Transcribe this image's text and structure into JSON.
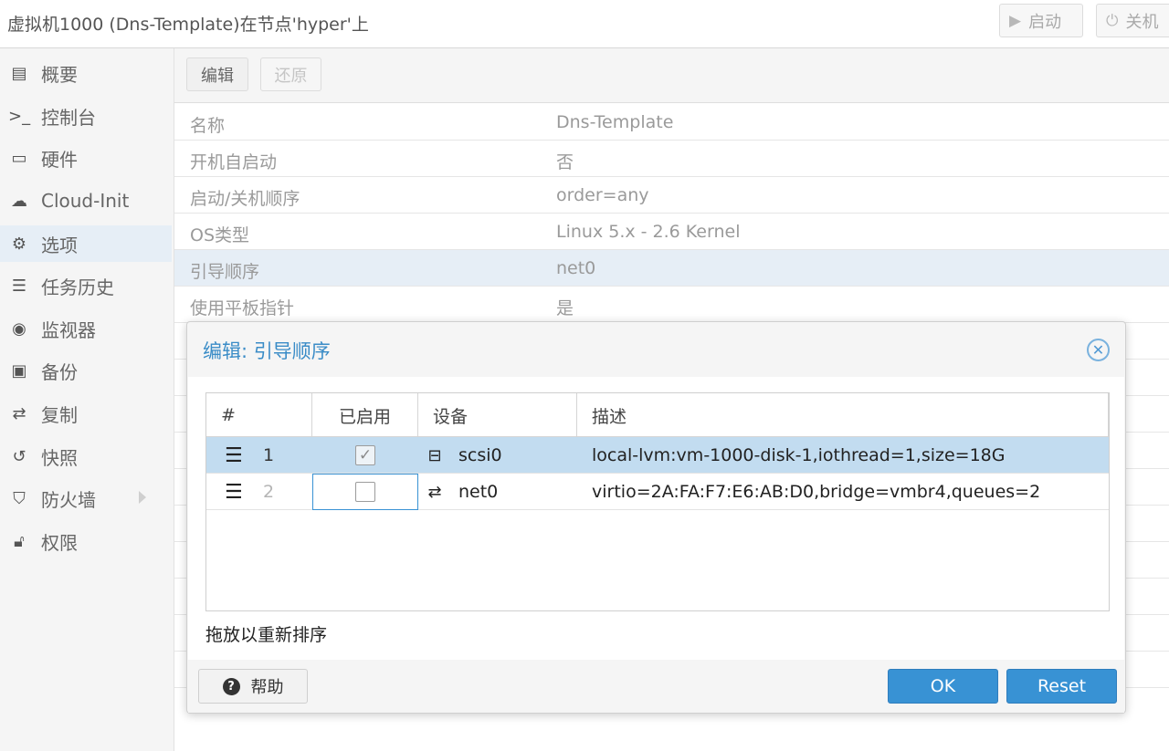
{
  "window": {
    "title": "虚拟机1000 (Dns-Template)在节点'hyper'上",
    "start_label": "启动",
    "shutdown_label": "关机"
  },
  "sidebar": {
    "items": [
      {
        "label": "概要",
        "icon": "book-icon"
      },
      {
        "label": "控制台",
        "icon": "terminal-icon"
      },
      {
        "label": "硬件",
        "icon": "monitor-icon"
      },
      {
        "label": "Cloud-Init",
        "icon": "cloud-icon"
      },
      {
        "label": "选项",
        "icon": "gear-icon",
        "active": true
      },
      {
        "label": "任务历史",
        "icon": "list-icon"
      },
      {
        "label": "监视器",
        "icon": "eye-icon"
      },
      {
        "label": "备份",
        "icon": "floppy-icon"
      },
      {
        "label": "复制",
        "icon": "retweet-icon"
      },
      {
        "label": "快照",
        "icon": "history-icon"
      },
      {
        "label": "防火墙",
        "icon": "shield-icon"
      },
      {
        "label": "权限",
        "icon": "unlock-icon"
      }
    ]
  },
  "options": {
    "toolbar": {
      "edit_label": "编辑",
      "revert_label": "还原"
    },
    "rows": [
      {
        "key": "名称",
        "value": "Dns-Template"
      },
      {
        "key": "开机自启动",
        "value": "否"
      },
      {
        "key": "启动/关机顺序",
        "value": "order=any"
      },
      {
        "key": "OS类型",
        "value": "Linux 5.x - 2.6 Kernel"
      },
      {
        "key": "引导顺序",
        "value": "net0"
      },
      {
        "key": "使用平板指针",
        "value": "是"
      }
    ]
  },
  "dialog": {
    "title": "编辑: 引导顺序",
    "columns": [
      "#",
      "已启用",
      "设备",
      "描述"
    ],
    "rows": [
      {
        "num": "1",
        "enabled": true,
        "device": "scsi0",
        "device_icon": "hdd-icon",
        "description": "local-lvm:vm-1000-disk-1,iothread=1,size=18G"
      },
      {
        "num": "2",
        "enabled": false,
        "device": "net0",
        "device_icon": "exchange-icon",
        "description": "virtio=2A:FA:F7:E6:AB:D0,bridge=vmbr4,queues=2"
      }
    ],
    "hint": "拖放以重新排序",
    "help_label": "帮助",
    "ok_label": "OK",
    "reset_label": "Reset"
  },
  "colors": {
    "accent": "#3892d4",
    "selection": "#c2dcf0",
    "title_blue": "#3a8cc7"
  }
}
